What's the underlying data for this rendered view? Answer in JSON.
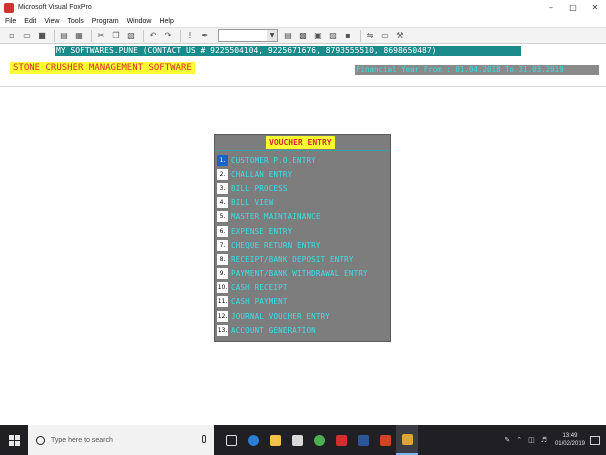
{
  "window": {
    "title": "Microsoft Visual FoxPro"
  },
  "menu": [
    "File",
    "Edit",
    "View",
    "Tools",
    "Program",
    "Window",
    "Help"
  ],
  "banner": {
    "company": "MY SOFTWARES.PUNE (CONTACT US # 9225504104, 9225671676, 8793555510, 8698650487)",
    "app_title": "STONE CRUSHER MANAGEMENT SOFTWARE",
    "financial_year": "Financial Year From : 01.04.2018 To 31.03.2019"
  },
  "voucher_menu": {
    "title": "VOUCHER ENTRY",
    "selected_index": 0,
    "items": [
      {
        "num": "1.",
        "label": "CUSTOMER P.O.ENTRY"
      },
      {
        "num": "2.",
        "label": "CHALLAN ENTRY"
      },
      {
        "num": "3.",
        "label": "BILL PROCESS"
      },
      {
        "num": "4.",
        "label": "BILL VIEW"
      },
      {
        "num": "5.",
        "label": "MASTER MAINTAINANCE"
      },
      {
        "num": "6.",
        "label": "EXPENSE ENTRY"
      },
      {
        "num": "7.",
        "label": "CHEQUE RETURN ENTRY"
      },
      {
        "num": "8.",
        "label": "RECEIPT/BANK DEPOSIT ENTRY"
      },
      {
        "num": "9.",
        "label": "PAYMENT/BANK WITHDRAWAL ENTRY"
      },
      {
        "num": "10.",
        "label": "CASH RECEIPT"
      },
      {
        "num": "11.",
        "label": "CASH PAYMENT"
      },
      {
        "num": "12.",
        "label": "JOURNAL VOUCHER ENTRY"
      },
      {
        "num": "13.",
        "label": "ACCOUNT GENERATION"
      }
    ]
  },
  "taskbar": {
    "search_placeholder": "Type here to search",
    "time": "13:49",
    "date": "01/02/2019"
  },
  "colors": {
    "banner_bg": "#1b8a8a",
    "title_bg": "#ffff33",
    "title_fg": "#d12b2b",
    "menu_fg": "#3be0e6",
    "panel_bg": "#7d7d7d"
  }
}
